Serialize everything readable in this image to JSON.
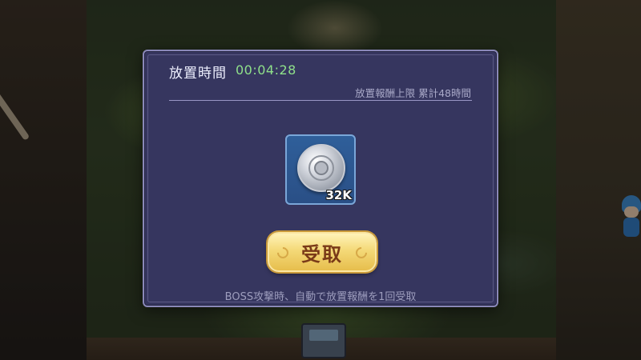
{
  "idle_panel": {
    "title": "放置時間",
    "elapsed_time": "00:04:28",
    "reward_cap_text": "放置報酬上限 累計48時間",
    "reward_item": {
      "icon": "silver-coin-icon",
      "count": "32K"
    },
    "claim_button_label": "受取",
    "footer_note": "BOSS攻撃時、自動で放置報酬を1回受取"
  },
  "colors": {
    "panel_bg": "#36365f",
    "timer_green": "#8fe08a",
    "button_gold": "#f4d978",
    "button_text": "#7a3a18"
  }
}
